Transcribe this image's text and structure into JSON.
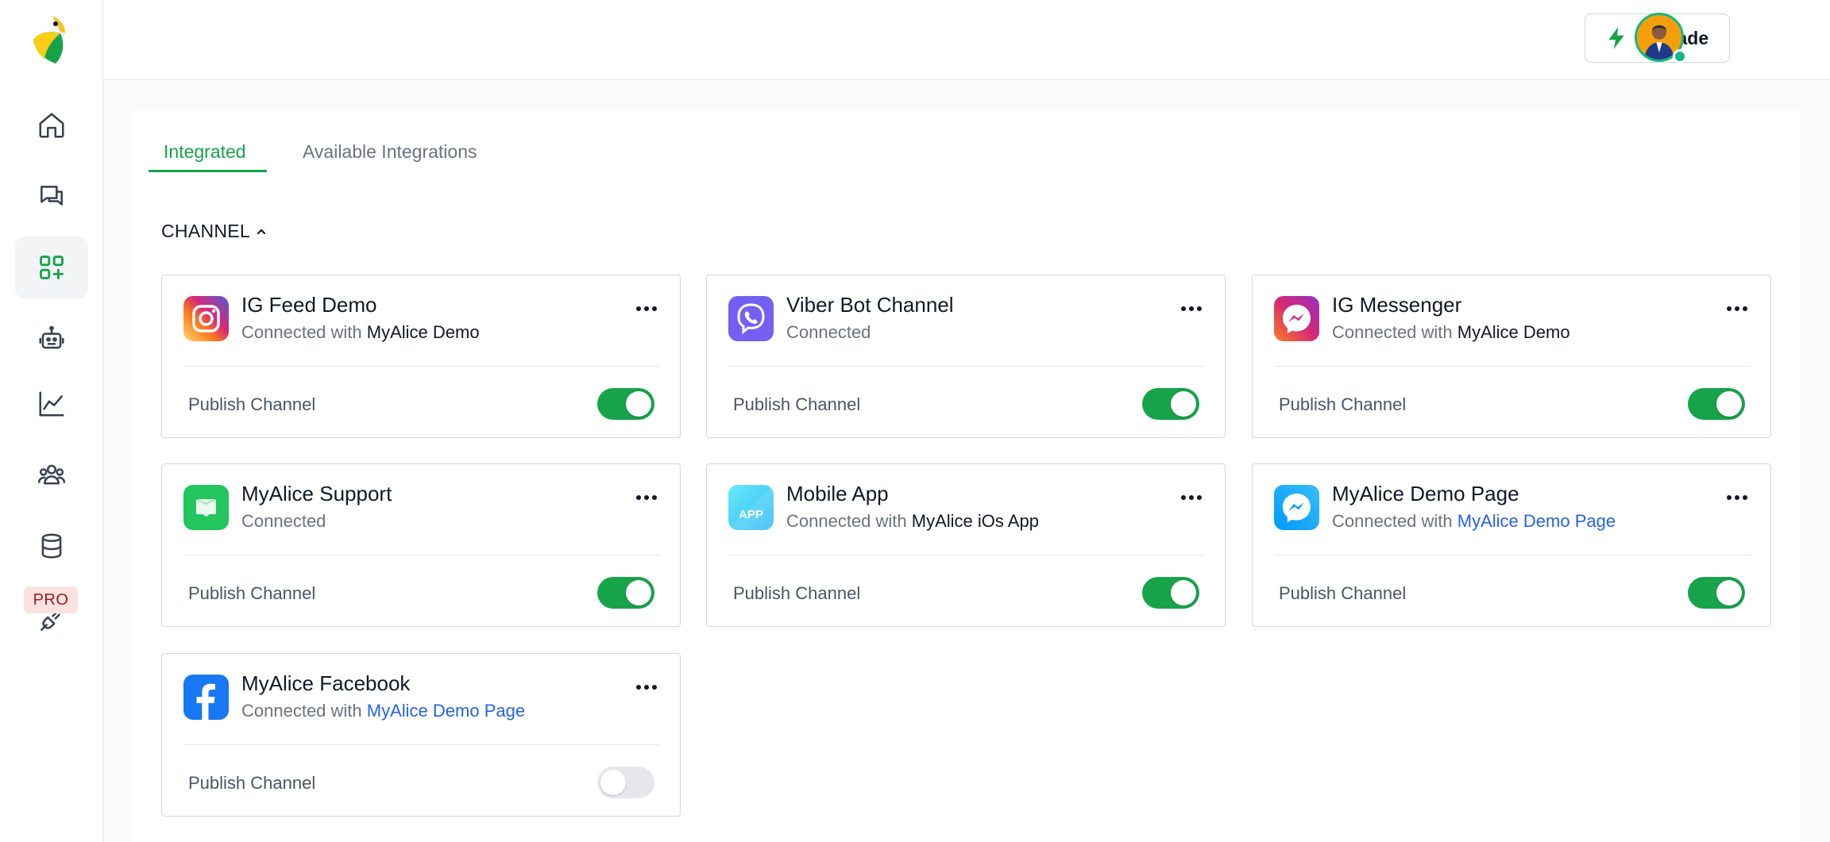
{
  "header": {
    "upgrade_label": "Upgrade"
  },
  "sidebar": {
    "pro_badge": "PRO",
    "items": [
      {
        "name": "home"
      },
      {
        "name": "inbox"
      },
      {
        "name": "integrations",
        "active": true
      },
      {
        "name": "bot"
      },
      {
        "name": "analytics"
      },
      {
        "name": "customers"
      },
      {
        "name": "data"
      },
      {
        "name": "plugins"
      }
    ]
  },
  "tabs": [
    {
      "label": "Integrated",
      "active": true
    },
    {
      "label": "Available Integrations",
      "active": false
    }
  ],
  "section": {
    "title": "CHANNEL"
  },
  "cards": [
    {
      "title": "IG Feed Demo",
      "status": "Connected with",
      "target": "MyAlice Demo",
      "target_link": false,
      "footer_label": "Publish Channel",
      "published": true,
      "icon": "instagram-icon"
    },
    {
      "title": "Viber Bot Channel",
      "status": "Connected",
      "target": "",
      "target_link": false,
      "footer_label": "Publish Channel",
      "published": true,
      "icon": "viber-icon"
    },
    {
      "title": "IG Messenger",
      "status": "Connected with",
      "target": "MyAlice Demo",
      "target_link": false,
      "footer_label": "Publish Channel",
      "published": true,
      "icon": "ig-messenger-icon"
    },
    {
      "title": "MyAlice Support",
      "status": "Connected",
      "target": "",
      "target_link": false,
      "footer_label": "Publish Channel",
      "published": true,
      "icon": "livechat-icon"
    },
    {
      "title": "Mobile App",
      "status": "Connected with",
      "target": "MyAlice iOs App",
      "target_link": false,
      "footer_label": "Publish Channel",
      "published": true,
      "icon": "app-icon",
      "icon_text": "APP"
    },
    {
      "title": "MyAlice Demo Page",
      "status": "Connected with",
      "target": "MyAlice Demo Page",
      "target_link": true,
      "footer_label": "Publish Channel",
      "published": true,
      "icon": "messenger-icon"
    },
    {
      "title": "MyAlice Facebook",
      "status": "Connected with",
      "target": "MyAlice Demo Page",
      "target_link": true,
      "footer_label": "Publish Channel",
      "published": false,
      "icon": "facebook-icon"
    }
  ],
  "colors": {
    "accent": "#16a34a",
    "link": "#2563eb",
    "toggle_off": "#e5e7eb"
  }
}
